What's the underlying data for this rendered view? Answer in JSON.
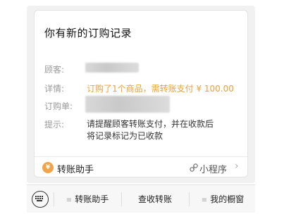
{
  "card": {
    "title": "你有新的订购记录",
    "fields": [
      {
        "label": "顾客:",
        "value": ""
      },
      {
        "label": "详情:",
        "value": "订购了1个商品，需转账支付 ¥ 100.00"
      },
      {
        "label": "订购单:",
        "value": ""
      },
      {
        "label": "提示:",
        "value": "请提醒顾客转账支付，并在收款后将记录标记为已收款"
      }
    ],
    "footer": {
      "app_icon": "transfer-assistant-icon",
      "app_name": "转账助手",
      "mini_program_icon": "mini-program-icon",
      "mini_program_label": "小程序",
      "chevron": "›"
    }
  },
  "bottom_bar": {
    "keyboard_icon": "keyboard-icon",
    "menu": [
      {
        "label": "转账助手",
        "has_submenu": true
      },
      {
        "label": "查收转账",
        "has_submenu": false
      },
      {
        "label": "我的橱窗",
        "has_submenu": true
      }
    ]
  },
  "colors": {
    "accent": "#e9a23b",
    "label_gray": "#9a9a9a",
    "background": "#f1f1f1"
  }
}
